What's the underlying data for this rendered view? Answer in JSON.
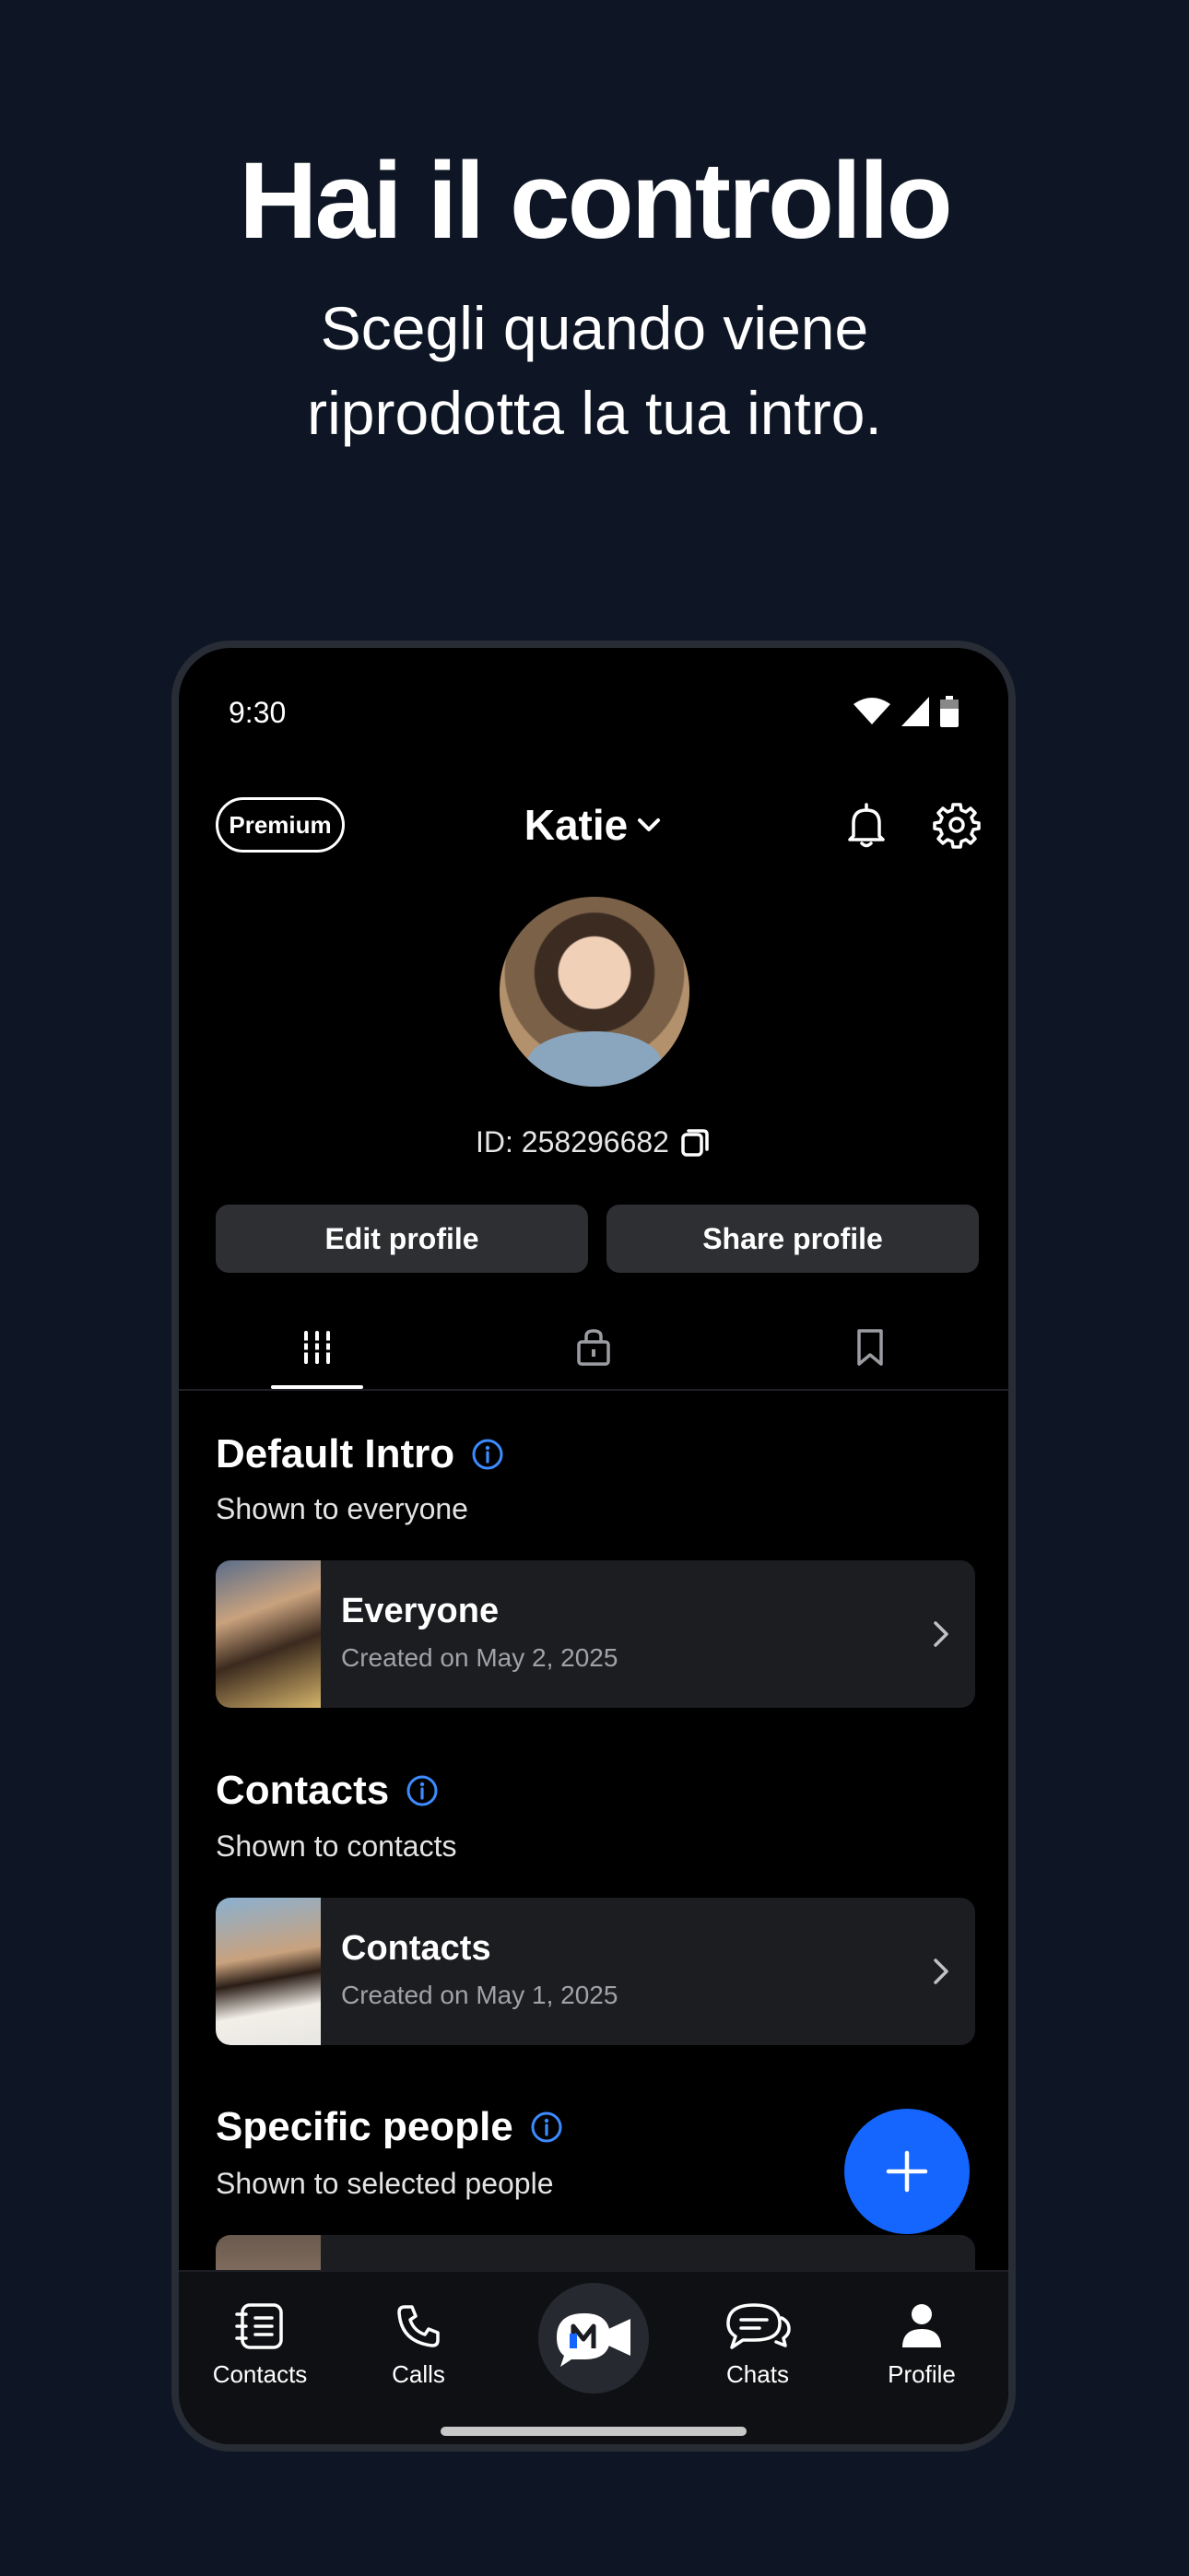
{
  "headline": "Hai il controllo",
  "subline": [
    "Scegli quando viene",
    "riprodotta la tua intro."
  ],
  "status": {
    "time": "9:30"
  },
  "header": {
    "premium_label": "Premium",
    "username": "Katie"
  },
  "profile": {
    "id_text": "ID: 258296682"
  },
  "buttons": {
    "edit": "Edit profile",
    "share": "Share profile"
  },
  "sections": [
    {
      "title": "Default Intro",
      "subtitle": "Shown to everyone",
      "card": {
        "name": "Everyone",
        "date": "Created on May 2, 2025"
      }
    },
    {
      "title": "Contacts",
      "subtitle": "Shown to contacts",
      "card": {
        "name": "Contacts",
        "date": "Created on May 1, 2025"
      }
    },
    {
      "title": "Specific people",
      "subtitle": "Shown to selected people"
    }
  ],
  "nav": {
    "contacts": "Contacts",
    "calls": "Calls",
    "chats": "Chats",
    "profile": "Profile"
  },
  "colors": {
    "background": "#0e1524",
    "accent": "#1565ff",
    "info": "#3d8bff",
    "card": "#1c1d20"
  }
}
